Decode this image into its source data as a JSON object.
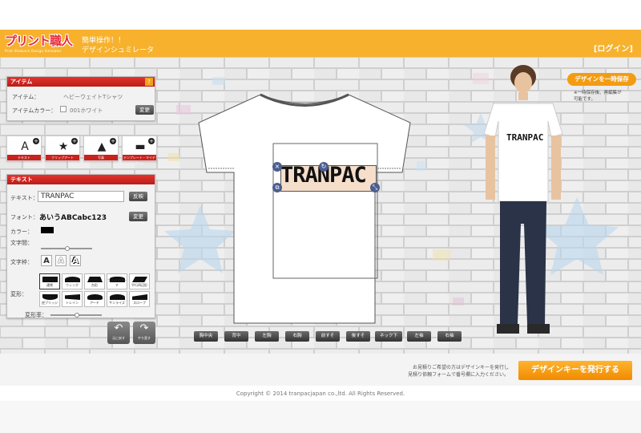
{
  "header": {
    "logo_text": "プリント職人",
    "logo_sub": "Print Shokunin Design Simulator",
    "tagline1": "簡単操作！！",
    "tagline2": "デザインシュミレータ",
    "login": "[ログイン]"
  },
  "item_panel": {
    "title": "アイテム",
    "help": "?",
    "item_label": "アイテム：",
    "item_value": "ヘビーウェイトTシャツ",
    "color_label": "アイテムカラー：",
    "color_value": "001ホワイト",
    "change": "変更"
  },
  "tools": [
    {
      "label": "テキスト",
      "icon": "A"
    },
    {
      "label": "クリップアート",
      "icon": "★"
    },
    {
      "label": "写真",
      "icon": "▲"
    },
    {
      "label": "テンプレート・マイデザイン",
      "icon": "▬"
    }
  ],
  "text_panel": {
    "title": "テキスト",
    "text_label": "テキスト：",
    "text_value": "TRANPAC",
    "reverse": "反映",
    "font_label": "フォント：",
    "font_sample": "あいうABCabc123",
    "font_change": "変更",
    "color_label": "カラー：",
    "spacing_label": "文字間：",
    "style_label": "文字枠：",
    "style_buttons": [
      "A",
      "A",
      "A"
    ],
    "deform_label": "変形：",
    "shapes_row1": [
      "通常",
      "ウィング",
      "台形",
      "ファイアアーチ",
      "平行四辺形"
    ],
    "shapes_row2": [
      "逆ブリッジ",
      "トレイン",
      "アーチ",
      "サンライズ",
      "スロープ"
    ],
    "deform_amount_label": "変形率："
  },
  "nav": {
    "undo": "元に戻す",
    "redo": "やり直す"
  },
  "canvas": {
    "design_text": "TRANPAC"
  },
  "model": {
    "shirt_text": "TRANPAC"
  },
  "positions": [
    "胸中央",
    "背中",
    "左胸",
    "右胸",
    "前すそ",
    "後すそ",
    "ネック下",
    "左袖",
    "右袖"
  ],
  "save": {
    "button": "デザインを一時保存",
    "note1": "※一時保存後、再編集が",
    "note2": "可能です。"
  },
  "issue": {
    "note1": "お見積りご希望の方はデザインキーを発行し",
    "note2": "見積り依頼フォームで番号欄に入力ください。",
    "button": "デザインキーを発行する"
  },
  "copyright": "Copyright © 2014 tranpacjapan co.,ltd. All Rights Reserved.",
  "colors": {
    "header": "#f7b12c",
    "accent_red": "#c9221d",
    "orange": "#f39c12"
  }
}
